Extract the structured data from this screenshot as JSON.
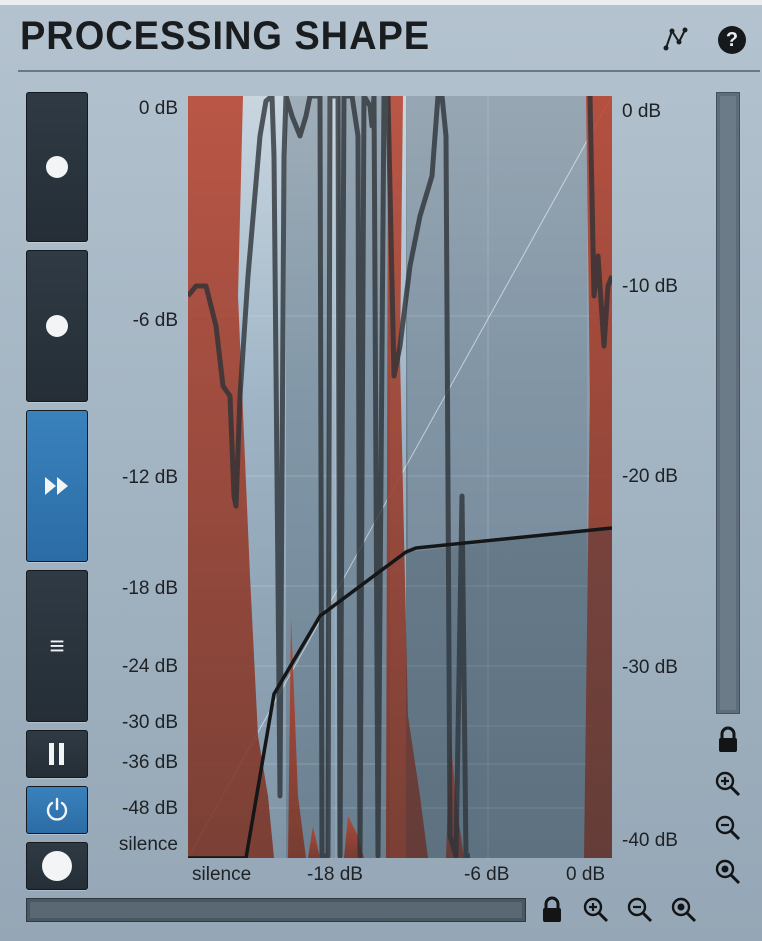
{
  "header": {
    "title": "PROCESSING SHAPE",
    "help_label": "?"
  },
  "sidebar": {
    "buttons": [
      {
        "name": "add-button",
        "icon": "plus-icon"
      },
      {
        "name": "remove-button",
        "icon": "minus-icon"
      },
      {
        "name": "forward-button",
        "icon": "fast-forward-icon",
        "active": true
      },
      {
        "name": "menu-button",
        "icon": "menu-icon",
        "glyph": "≡"
      },
      {
        "name": "pause-button",
        "icon": "pause-icon"
      },
      {
        "name": "power-button",
        "icon": "power-icon",
        "active": true
      },
      {
        "name": "help-button",
        "icon": "question-icon",
        "glyph": "?"
      }
    ]
  },
  "graph": {
    "left_labels": [
      "0 dB",
      "-6 dB",
      "-12 dB",
      "-18 dB",
      "-24 dB",
      "-30 dB",
      "-36 dB",
      "-48 dB",
      "silence"
    ],
    "right_labels": [
      "0 dB",
      "-10 dB",
      "-20 dB",
      "-30 dB",
      "-40 dB"
    ],
    "bottom_labels": [
      "silence",
      "-18 dB",
      "-6 dB",
      "0 dB"
    ]
  },
  "colors": {
    "accent": "#3a82bd",
    "spectrum_red": "#b24a3a",
    "curve": "#141618",
    "button_dark": "#28323b"
  }
}
